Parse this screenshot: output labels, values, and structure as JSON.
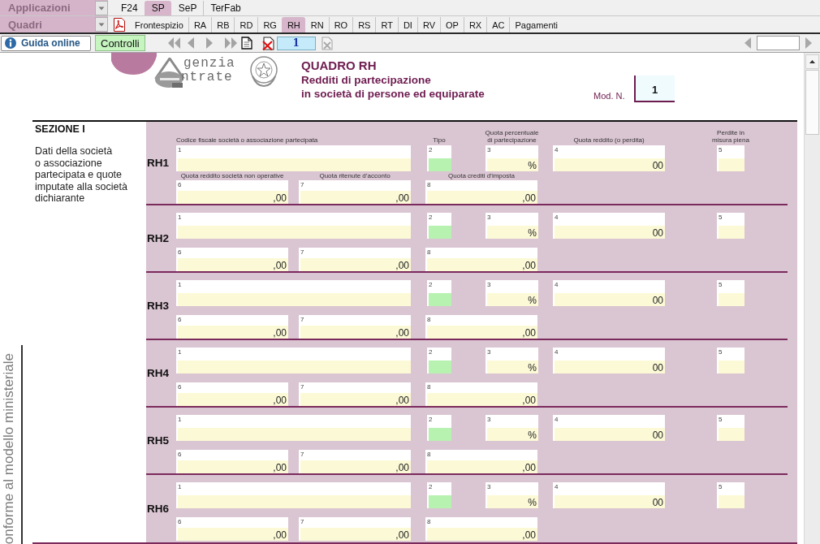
{
  "app_menu": {
    "dropdown": "Applicazioni",
    "tabs": [
      {
        "label": "F24",
        "selected": false
      },
      {
        "label": "SP",
        "selected": true
      },
      {
        "label": "SeP",
        "selected": false
      },
      {
        "label": "TerFab",
        "selected": false
      }
    ]
  },
  "quadri_menu": {
    "dropdown": "Quadri",
    "tabs": [
      {
        "label": "Frontespizio",
        "selected": false
      },
      {
        "label": "RA",
        "selected": false
      },
      {
        "label": "RB",
        "selected": false
      },
      {
        "label": "RD",
        "selected": false
      },
      {
        "label": "RG",
        "selected": false
      },
      {
        "label": "RH",
        "selected": true
      },
      {
        "label": "RN",
        "selected": false
      },
      {
        "label": "RO",
        "selected": false
      },
      {
        "label": "RS",
        "selected": false
      },
      {
        "label": "RT",
        "selected": false
      },
      {
        "label": "DI",
        "selected": false
      },
      {
        "label": "RV",
        "selected": false
      },
      {
        "label": "OP",
        "selected": false
      },
      {
        "label": "RX",
        "selected": false
      },
      {
        "label": "AC",
        "selected": false
      },
      {
        "label": "Pagamenti",
        "selected": false
      }
    ]
  },
  "toolbar": {
    "help_button": "Guida online",
    "check_button": "Controlli",
    "page_number": "1"
  },
  "form_header": {
    "logo_top": "genzia",
    "logo_bottom": "ntrate",
    "title": "QUADRO RH",
    "subtitle": "Redditi di partecipazione\nin società di persone ed equiparate",
    "model_label": "Mod. N.",
    "model_number": "1"
  },
  "side_note": "onforme al modello ministeriale",
  "section": {
    "title": "SEZIONE I",
    "description": "Dati della società\no associazione\npartecipata e quote\nimputate alla società\ndichiarante",
    "rows": [
      {
        "code": "RH1",
        "fields": [
          {
            "number": "1",
            "kind": "text",
            "label": "Codice fiscale società o associazione partecipata"
          },
          {
            "number": "2",
            "kind": "code",
            "label": "Tipo"
          },
          {
            "number": "3",
            "kind": "percent",
            "suffix": "%",
            "label": "Quota percentuale\ndi partecipazione"
          },
          {
            "number": "4",
            "kind": "amount",
            "suffix": "00",
            "label": "Quota reddito (o perdita)"
          },
          {
            "number": "5",
            "kind": "flag",
            "label": "Perdite in\nmisura piena"
          },
          {
            "number": "6",
            "kind": "amount",
            "suffix": ",00",
            "label": "Quota reddito società non operative"
          },
          {
            "number": "7",
            "kind": "amount",
            "suffix": ",00",
            "label": "Quota ritenute d’acconto"
          },
          {
            "number": "8",
            "kind": "amount",
            "suffix": ",00",
            "label": "Quota crediti d’imposta"
          }
        ]
      },
      {
        "code": "RH2",
        "fields": [
          {
            "number": "1",
            "kind": "text"
          },
          {
            "number": "2",
            "kind": "code"
          },
          {
            "number": "3",
            "kind": "percent",
            "suffix": "%"
          },
          {
            "number": "4",
            "kind": "amount",
            "suffix": "00"
          },
          {
            "number": "5",
            "kind": "flag"
          },
          {
            "number": "6",
            "kind": "amount",
            "suffix": ",00"
          },
          {
            "number": "7",
            "kind": "amount",
            "suffix": ",00"
          },
          {
            "number": "8",
            "kind": "amount",
            "suffix": ",00"
          }
        ]
      },
      {
        "code": "RH3",
        "fields": [
          {
            "number": "1",
            "kind": "text"
          },
          {
            "number": "2",
            "kind": "code"
          },
          {
            "number": "3",
            "kind": "percent",
            "suffix": "%"
          },
          {
            "number": "4",
            "kind": "amount",
            "suffix": "00"
          },
          {
            "number": "5",
            "kind": "flag"
          },
          {
            "number": "6",
            "kind": "amount",
            "suffix": ",00"
          },
          {
            "number": "7",
            "kind": "amount",
            "suffix": ",00"
          },
          {
            "number": "8",
            "kind": "amount",
            "suffix": ",00"
          }
        ]
      },
      {
        "code": "RH4",
        "fields": [
          {
            "number": "1",
            "kind": "text"
          },
          {
            "number": "2",
            "kind": "code"
          },
          {
            "number": "3",
            "kind": "percent",
            "suffix": "%"
          },
          {
            "number": "4",
            "kind": "amount",
            "suffix": "00"
          },
          {
            "number": "5",
            "kind": "flag"
          },
          {
            "number": "6",
            "kind": "amount",
            "suffix": ",00"
          },
          {
            "number": "7",
            "kind": "amount",
            "suffix": ",00"
          },
          {
            "number": "8",
            "kind": "amount",
            "suffix": ",00"
          }
        ]
      },
      {
        "code": "RH5",
        "fields": [
          {
            "number": "1",
            "kind": "text"
          },
          {
            "number": "2",
            "kind": "code"
          },
          {
            "number": "3",
            "kind": "percent",
            "suffix": "%"
          },
          {
            "number": "4",
            "kind": "amount",
            "suffix": "00"
          },
          {
            "number": "5",
            "kind": "flag"
          },
          {
            "number": "6",
            "kind": "amount",
            "suffix": ",00"
          },
          {
            "number": "7",
            "kind": "amount",
            "suffix": ",00"
          },
          {
            "number": "8",
            "kind": "amount",
            "suffix": ",00"
          }
        ]
      },
      {
        "code": "RH6",
        "fields": [
          {
            "number": "1",
            "kind": "text"
          },
          {
            "number": "2",
            "kind": "code"
          },
          {
            "number": "3",
            "kind": "percent",
            "suffix": "%"
          },
          {
            "number": "4",
            "kind": "amount",
            "suffix": "00"
          },
          {
            "number": "5",
            "kind": "flag"
          },
          {
            "number": "6",
            "kind": "amount",
            "suffix": ",00"
          },
          {
            "number": "7",
            "kind": "amount",
            "suffix": ",00"
          },
          {
            "number": "8",
            "kind": "amount",
            "suffix": ",00"
          }
        ]
      }
    ]
  }
}
